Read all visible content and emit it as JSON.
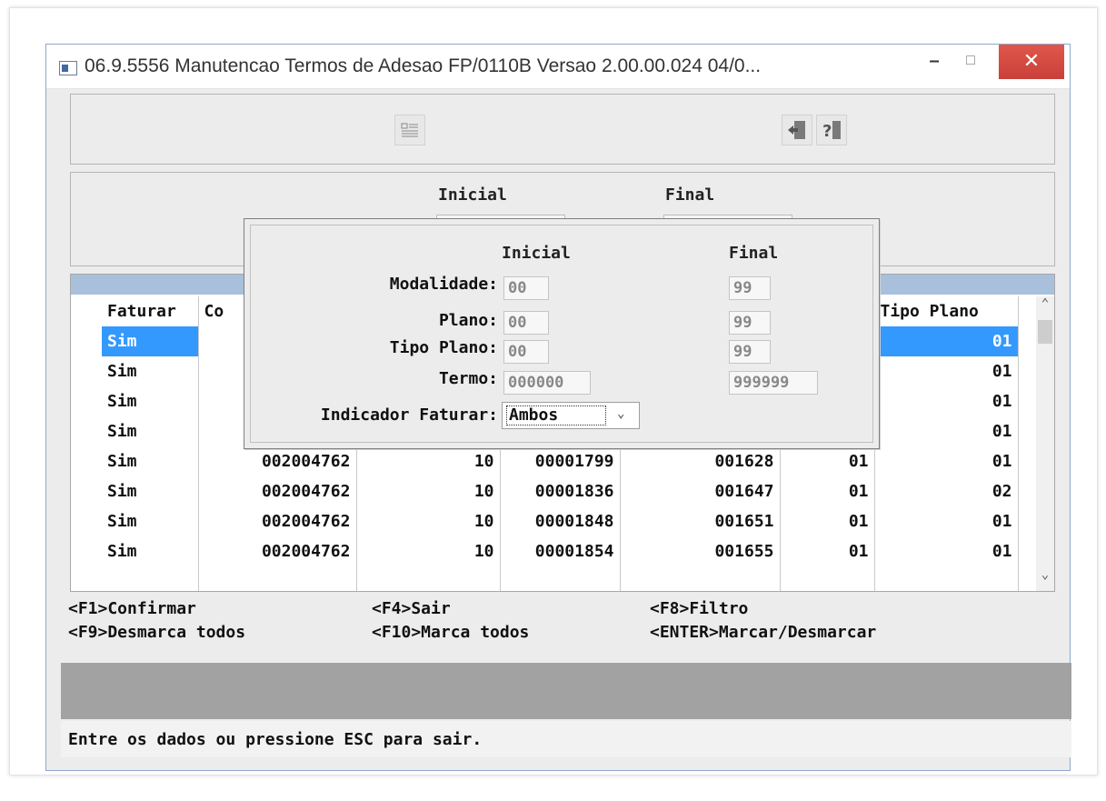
{
  "window": {
    "title": "06.9.5556 Manutencao  Termos de Adesao FP/0110B Versao 2.00.00.024 04/0...",
    "minimize": "–",
    "maximize": "□",
    "close": "✕"
  },
  "toolbar": {
    "filter_icon": "filter-list-icon",
    "exit_icon": "exit-door-icon",
    "help_icon": "help-icon"
  },
  "range": {
    "inicial_label": "Inicial",
    "final_label": "Final"
  },
  "grid": {
    "columns": [
      "Faturar",
      "Co",
      "",
      "",
      "",
      "",
      "Tipo Plano"
    ],
    "rows": [
      {
        "faturar": "Sim",
        "contratante": "",
        "modalidade": "",
        "termo": "",
        "proposta": "",
        "plano": "",
        "tipo_plano": "01"
      },
      {
        "faturar": "Sim",
        "contratante": "",
        "modalidade": "",
        "termo": "",
        "proposta": "",
        "plano": "",
        "tipo_plano": "01"
      },
      {
        "faturar": "Sim",
        "contratante": "",
        "modalidade": "",
        "termo": "",
        "proposta": "",
        "plano": "",
        "tipo_plano": "01"
      },
      {
        "faturar": "Sim",
        "contratante": "",
        "modalidade": "",
        "termo": "",
        "proposta": "",
        "plano": "",
        "tipo_plano": "01"
      },
      {
        "faturar": "Sim",
        "contratante": "002004762",
        "modalidade": "10",
        "termo": "00001799",
        "proposta": "001628",
        "plano": "01",
        "tipo_plano": "01"
      },
      {
        "faturar": "Sim",
        "contratante": "002004762",
        "modalidade": "10",
        "termo": "00001836",
        "proposta": "001647",
        "plano": "01",
        "tipo_plano": "02"
      },
      {
        "faturar": "Sim",
        "contratante": "002004762",
        "modalidade": "10",
        "termo": "00001848",
        "proposta": "001651",
        "plano": "01",
        "tipo_plano": "01"
      },
      {
        "faturar": "Sim",
        "contratante": "002004762",
        "modalidade": "10",
        "termo": "00001854",
        "proposta": "001655",
        "plano": "01",
        "tipo_plano": "01"
      }
    ]
  },
  "hotkeys": {
    "f1": "<F1>Confirmar",
    "f4": "<F4>Sair",
    "f8": "<F8>Filtro",
    "f9": "<F9>Desmarca todos",
    "f10": "<F10>Marca todos",
    "enter": "<ENTER>Marcar/Desmarcar"
  },
  "status": {
    "message": "Entre os dados ou pressione ESC para sair."
  },
  "dialog": {
    "inicial_label": "Inicial",
    "final_label": "Final",
    "modalidade_label": "Modalidade:",
    "plano_label": "Plano:",
    "tipo_plano_label": "Tipo Plano:",
    "termo_label": "Termo:",
    "indicador_label": "Indicador Faturar:",
    "modalidade_inicial": "00",
    "modalidade_final": "99",
    "plano_inicial": "00",
    "plano_final": "99",
    "tipo_plano_inicial": "00",
    "tipo_plano_final": "99",
    "termo_inicial": "000000",
    "termo_final": "999999",
    "indicador_value": "Ambos"
  },
  "colors": {
    "selection": "#3399ff",
    "grid_header_band": "#a8c0dc",
    "close_button": "#d9534f",
    "gray_bar": "#a2a2a2"
  }
}
